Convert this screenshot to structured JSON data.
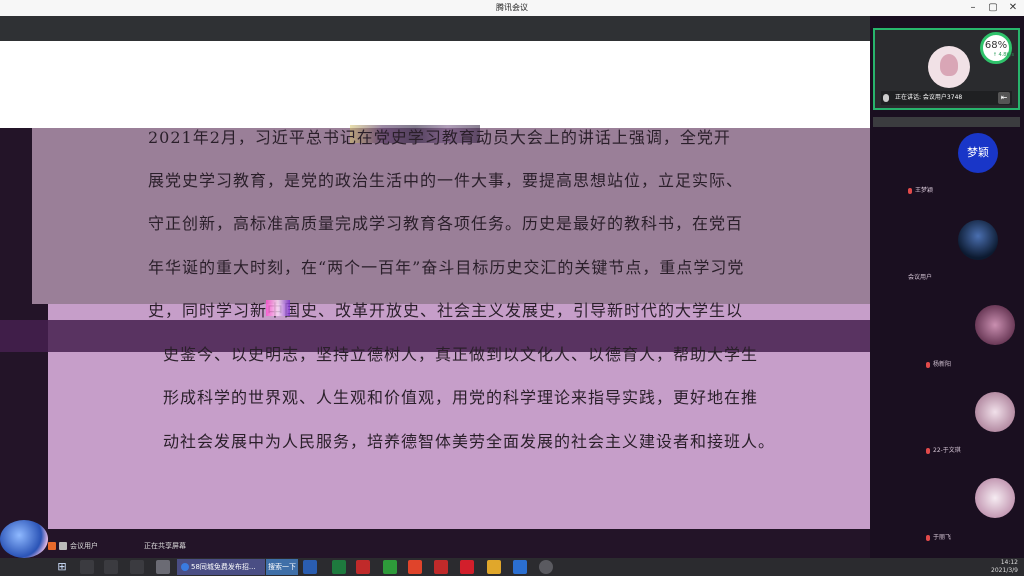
{
  "window": {
    "title": "腾讯会议",
    "controls": {
      "minimize": "–",
      "maximize": "▢",
      "close": "✕"
    }
  },
  "slide": {
    "lines": [
      "2021年2月，习近平总书记在党史学习教育动员大会上的讲话上强调，全党开",
      "展党史学习教育，是党的政治生活中的一件大事，要提高思想站位，立足实际、",
      "守正创新，高标准高质量完成学习教育各项任务。历史是最好的教科书，在党百",
      "年华诞的重大时刻，在“两个一百年”奋斗目标历史交汇的关键节点，重点学习党",
      "史，同时学习新中国史、改革开放史、社会主义发展史，引导新时代的大学生以",
      "史鉴今、以史明志，坚持立德树人，真正做到以文化人、以德育人，帮助大学生",
      "形成科学的世界观、人生观和价值观，用党的科学理论来指导实践，更好地在推",
      "动社会发展中为人民服务，培养德智体美劳全面发展的社会主义建设者和接班人。"
    ]
  },
  "speaker": {
    "label": "正在讲话: 会议用户3748",
    "network": {
      "percent": "68%",
      "speed": "↑ 4.8K/s"
    }
  },
  "participants": [
    {
      "avatar_text": "梦颖",
      "name": "王梦颖",
      "color": "#1936c8"
    },
    {
      "avatar_text": "",
      "name": "会议用户",
      "color": "#243d6b"
    },
    {
      "avatar_text": "",
      "name": "杨新阳",
      "color": "#b07a9a"
    },
    {
      "avatar_text": "",
      "name": "22-于文琪",
      "color": "#d9b6c6"
    },
    {
      "avatar_text": "",
      "name": "于丽飞",
      "color": "#e6d2dc"
    }
  ],
  "controls": {
    "self_label": "会议用户",
    "status": "正在共享屏幕"
  },
  "taskbar": {
    "start_icon": "windows-logo",
    "apps": [
      {
        "label": "58同城免费发布招...",
        "color": "#4a4e84"
      },
      {
        "label": "搜索一下",
        "color": "#3f6fa8"
      }
    ],
    "clock": {
      "time": "14:12",
      "date": "2021/3/9"
    }
  }
}
